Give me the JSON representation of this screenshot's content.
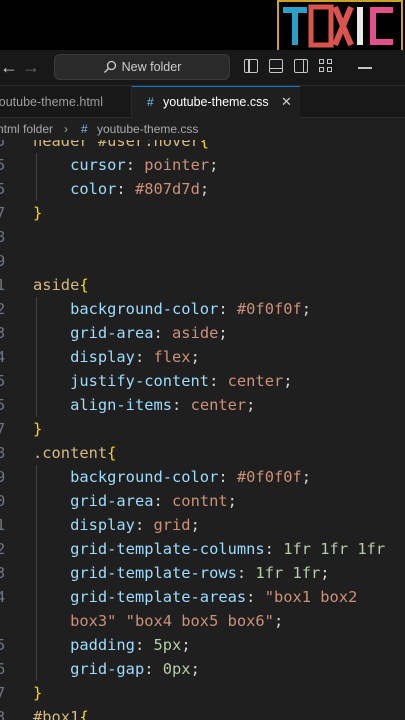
{
  "watermark": {
    "text": "TOXIC"
  },
  "titlebar": {
    "back_icon": "arrow-left-icon",
    "forward_icon": "arrow-right-icon",
    "search_label": "New folder",
    "search_icon": "search-icon"
  },
  "tabs": [
    {
      "label": "youtube-theme.html",
      "active": false
    },
    {
      "label": "youtube-theme.css",
      "active": true,
      "icon": "#",
      "close": "✕"
    }
  ],
  "breadcrumb": {
    "folder": "html folder",
    "separator": "›",
    "icon": "#",
    "file": "youtube-theme.css"
  },
  "colors": {
    "selector": "#d7ba7d",
    "property": "#9cdcfe",
    "value": "#ce9178",
    "number": "#b5cea8",
    "bracket": "#ffd700",
    "line_number": "#6e7681"
  },
  "code": {
    "lines": [
      {
        "n": "5",
        "tokens": [
          [
            "sel",
            "header #user:hover"
          ],
          [
            "br",
            "{"
          ]
        ]
      },
      {
        "n": "5",
        "tokens": [
          [
            "pun",
            "    "
          ],
          [
            "prop",
            "cursor"
          ],
          [
            "pun",
            ": "
          ],
          [
            "val",
            "pointer"
          ],
          [
            "pun",
            ";"
          ]
        ]
      },
      {
        "n": "5",
        "tokens": [
          [
            "pun",
            "    "
          ],
          [
            "prop",
            "color"
          ],
          [
            "pun",
            ": "
          ],
          [
            "val",
            "#807d7d"
          ],
          [
            "pun",
            ";"
          ]
        ]
      },
      {
        "n": "7",
        "tokens": [
          [
            "br",
            "}"
          ]
        ]
      },
      {
        "n": "8",
        "tokens": []
      },
      {
        "n": "9",
        "tokens": []
      },
      {
        "n": "1",
        "tokens": [
          [
            "sel",
            "aside"
          ],
          [
            "br",
            "{"
          ]
        ]
      },
      {
        "n": "2",
        "tokens": [
          [
            "pun",
            "    "
          ],
          [
            "prop",
            "background-color"
          ],
          [
            "pun",
            ": "
          ],
          [
            "val",
            "#0f0f0f"
          ],
          [
            "pun",
            ";"
          ]
        ]
      },
      {
        "n": "3",
        "tokens": [
          [
            "pun",
            "    "
          ],
          [
            "prop",
            "grid-area"
          ],
          [
            "pun",
            ": "
          ],
          [
            "val",
            "aside"
          ],
          [
            "pun",
            ";"
          ]
        ]
      },
      {
        "n": "4",
        "tokens": [
          [
            "pun",
            "    "
          ],
          [
            "prop",
            "display"
          ],
          [
            "pun",
            ": "
          ],
          [
            "val",
            "flex"
          ],
          [
            "pun",
            ";"
          ]
        ]
      },
      {
        "n": "5",
        "tokens": [
          [
            "pun",
            "    "
          ],
          [
            "prop",
            "justify-content"
          ],
          [
            "pun",
            ": "
          ],
          [
            "val",
            "center"
          ],
          [
            "pun",
            ";"
          ]
        ]
      },
      {
        "n": "5",
        "tokens": [
          [
            "pun",
            "    "
          ],
          [
            "prop",
            "align-items"
          ],
          [
            "pun",
            ": "
          ],
          [
            "val",
            "center"
          ],
          [
            "pun",
            ";"
          ]
        ]
      },
      {
        "n": "7",
        "tokens": [
          [
            "br",
            "}"
          ]
        ]
      },
      {
        "n": "8",
        "tokens": [
          [
            "sel",
            ".content"
          ],
          [
            "br",
            "{"
          ]
        ]
      },
      {
        "n": "9",
        "tokens": [
          [
            "pun",
            "    "
          ],
          [
            "prop",
            "background-color"
          ],
          [
            "pun",
            ": "
          ],
          [
            "val",
            "#0f0f0f"
          ],
          [
            "pun",
            ";"
          ]
        ]
      },
      {
        "n": "0",
        "tokens": [
          [
            "pun",
            "    "
          ],
          [
            "prop",
            "grid-area"
          ],
          [
            "pun",
            ": "
          ],
          [
            "val",
            "contnt"
          ],
          [
            "pun",
            ";"
          ]
        ]
      },
      {
        "n": "1",
        "tokens": [
          [
            "pun",
            "    "
          ],
          [
            "prop",
            "display"
          ],
          [
            "pun",
            ": "
          ],
          [
            "val",
            "grid"
          ],
          [
            "pun",
            ";"
          ]
        ]
      },
      {
        "n": "2",
        "tokens": [
          [
            "pun",
            "    "
          ],
          [
            "prop",
            "grid-template-columns"
          ],
          [
            "pun",
            ": "
          ],
          [
            "num",
            "1fr 1fr 1fr"
          ]
        ]
      },
      {
        "n": "3",
        "tokens": [
          [
            "pun",
            "    "
          ],
          [
            "prop",
            "grid-template-rows"
          ],
          [
            "pun",
            ": "
          ],
          [
            "num",
            "1fr 1fr"
          ],
          [
            "pun",
            ";"
          ]
        ]
      },
      {
        "n": "4",
        "tokens": [
          [
            "pun",
            "    "
          ],
          [
            "prop",
            "grid-template-areas"
          ],
          [
            "pun",
            ": "
          ],
          [
            "val",
            "\"box1 box2"
          ]
        ]
      },
      {
        "n": "",
        "tokens": [
          [
            "pun",
            "    "
          ],
          [
            "val",
            "box3\" \"box4 box5 box6\""
          ],
          [
            "pun",
            ";"
          ]
        ]
      },
      {
        "n": "5",
        "tokens": [
          [
            "pun",
            "    "
          ],
          [
            "prop",
            "padding"
          ],
          [
            "pun",
            ": "
          ],
          [
            "num",
            "5px"
          ],
          [
            "pun",
            ";"
          ]
        ]
      },
      {
        "n": "6",
        "tokens": [
          [
            "pun",
            "    "
          ],
          [
            "prop",
            "grid-gap"
          ],
          [
            "pun",
            ": "
          ],
          [
            "num",
            "0px"
          ],
          [
            "pun",
            ";"
          ]
        ]
      },
      {
        "n": "7",
        "tokens": [
          [
            "br",
            "}"
          ]
        ]
      },
      {
        "n": "3",
        "tokens": [
          [
            "sel",
            "#box1"
          ],
          [
            "br",
            "{"
          ]
        ]
      }
    ]
  }
}
